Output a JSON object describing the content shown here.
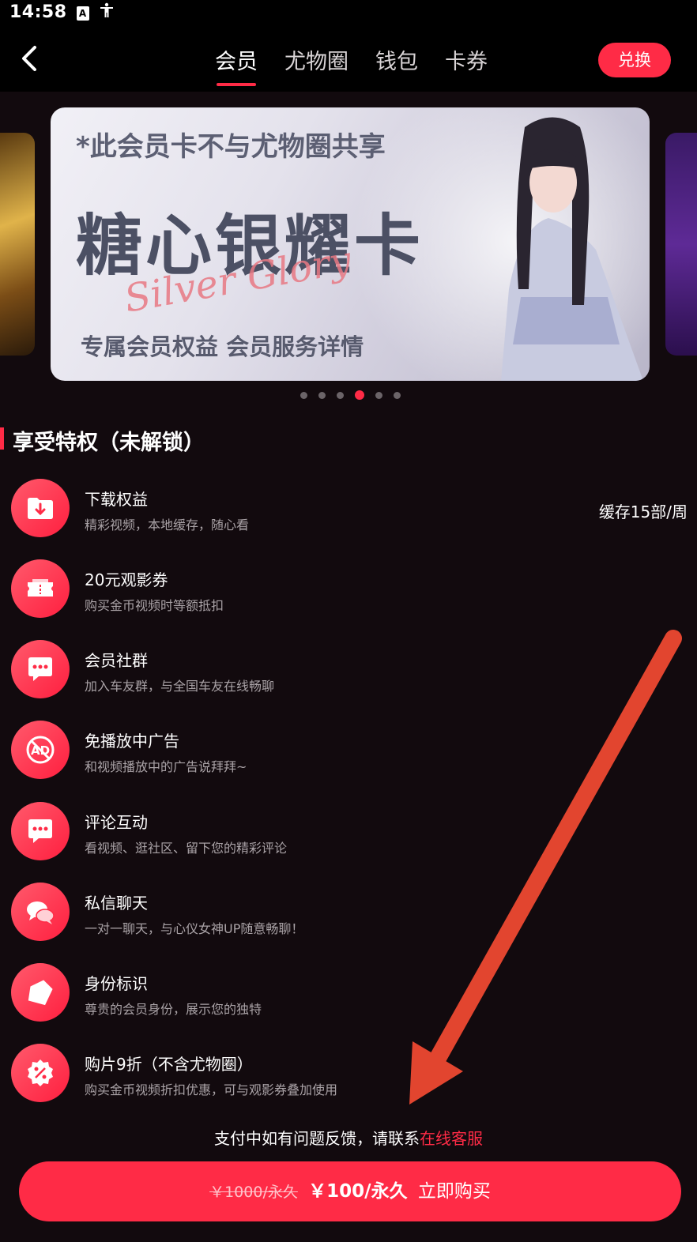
{
  "status_bar": {
    "time": "14:58",
    "icons": [
      "text-a-icon",
      "accessibility-icon"
    ]
  },
  "header": {
    "tabs": [
      {
        "label": "会员",
        "active": true
      },
      {
        "label": "尤物圈",
        "active": false
      },
      {
        "label": "钱包",
        "active": false
      },
      {
        "label": "卡券",
        "active": false
      }
    ],
    "redeem_label": "兑换"
  },
  "banner": {
    "note": "*此会员卡不与尤物圈共享",
    "title": "糖心银耀卡",
    "script": "Silver Glory",
    "footer": "专属会员权益 会员服务详情",
    "dots": 6,
    "active_dot": 4
  },
  "section": {
    "title": "享受特权（未解锁）"
  },
  "privileges": [
    {
      "icon": "download-folder-icon",
      "title": "下载权益",
      "subtitle": "精彩视频，本地缓存，随心看",
      "extra": "缓存15部/周"
    },
    {
      "icon": "ticket-icon",
      "title": "20元观影券",
      "subtitle": "购买金币视频时等额抵扣"
    },
    {
      "icon": "chat-bubble-icon",
      "title": "会员社群",
      "subtitle": "加入车友群，与全国车友在线畅聊"
    },
    {
      "icon": "no-ads-icon",
      "title": "免播放中广告",
      "subtitle": "和视频播放中的广告说拜拜~"
    },
    {
      "icon": "comment-icon",
      "title": "评论互动",
      "subtitle": "看视频、逛社区、留下您的精彩评论"
    },
    {
      "icon": "private-message-icon",
      "title": "私信聊天",
      "subtitle": "一对一聊天，与心仪女神UP随意畅聊！"
    },
    {
      "icon": "identity-badge-icon",
      "title": "身份标识",
      "subtitle": "尊贵的会员身份，展示您的独特"
    },
    {
      "icon": "discount-icon",
      "title": "购片9折（不含尤物圈）",
      "subtitle": "购买金币视频折扣优惠，可与观影券叠加使用"
    }
  ],
  "support": {
    "text": "支付中如有问题反馈，请联系",
    "link": "在线客服"
  },
  "purchase": {
    "old_price": "￥1000/永久",
    "new_price": "￥100/永久",
    "label": "立即购买"
  },
  "colors": {
    "accent": "#ff2b46",
    "background": "#120a0e",
    "annotation_arrow": "#e2452f"
  }
}
